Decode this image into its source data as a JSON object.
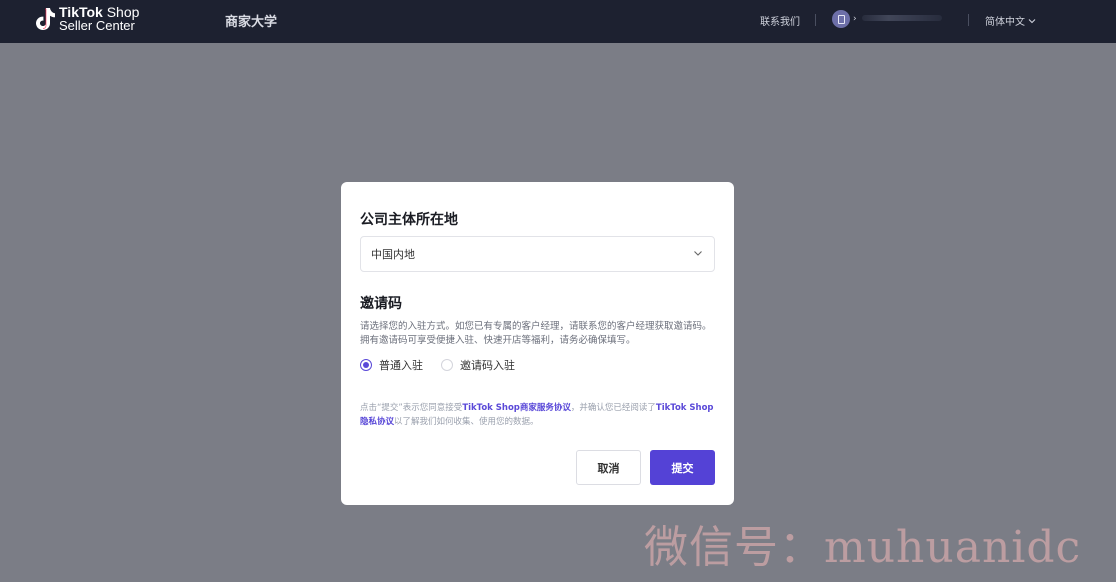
{
  "header": {
    "brand_line1_bold": "TikTok",
    "brand_line1_light": " Shop",
    "brand_line2": "Seller Center",
    "academy": "商家大学",
    "contact": "联系我们",
    "language": "简体中文"
  },
  "modal": {
    "location_title": "公司主体所在地",
    "location_value": "中国内地",
    "invite_title": "邀请码",
    "invite_desc": "请选择您的入驻方式。如您已有专属的客户经理，请联系您的客户经理获取邀请码。拥有邀请码可享受便捷入驻、快速开店等福利，请务必确保填写。",
    "options": [
      {
        "label": "普通入驻",
        "selected": true
      },
      {
        "label": "邀请码入驻",
        "selected": false
      }
    ],
    "agree_prefix": "点击“提交”表示您同意接受",
    "agree_link1": "TikTok Shop商家服务协议",
    "agree_mid": "，并确认您已经阅读了",
    "agree_link2": "TikTok Shop隐私协议",
    "agree_suffix": "以了解我们如何收集、使用您的数据。",
    "cancel_label": "取消",
    "submit_label": "提交"
  },
  "watermark": "微信号：muhuanidc",
  "colors": {
    "accent": "#5442d6",
    "header_bg": "#1d2130",
    "overlay": "#7b7d86"
  }
}
